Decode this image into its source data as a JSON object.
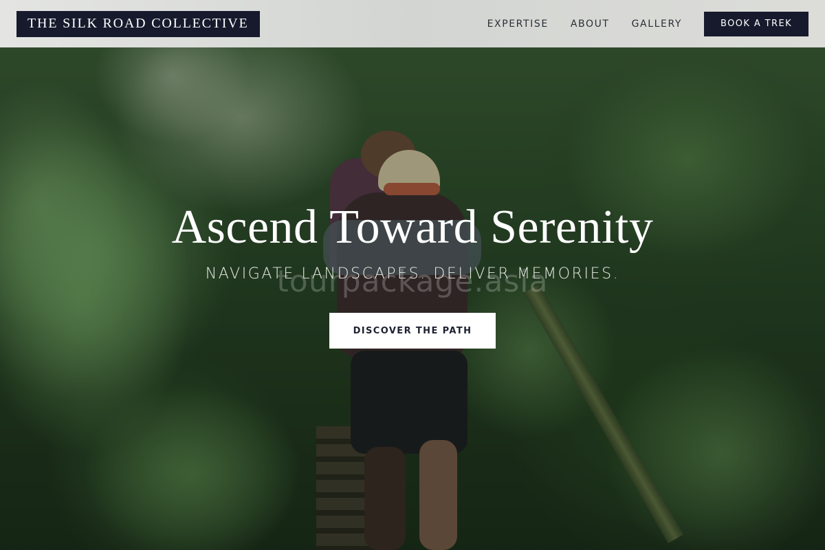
{
  "header": {
    "logo": "THE SILK ROAD COLLECTIVE",
    "nav": [
      {
        "label": "EXPERTISE"
      },
      {
        "label": "ABOUT"
      },
      {
        "label": "GALLERY"
      }
    ],
    "cta_label": "BOOK A TREK"
  },
  "hero": {
    "title": "Ascend Toward Serenity",
    "subtitle": "NAVIGATE LANDSCAPES. DELIVER MEMORIES.",
    "watermark": "tourpackage.asia",
    "cta_label": "DISCOVER THE PATH",
    "image_description": "hiker with backpack climbing wooden steps through a dense fern forest"
  },
  "colors": {
    "brand_navy": "#161a2c",
    "header_bg": "#dcddd9",
    "hero_cta_bg": "#ffffff",
    "hero_text": "#ffffff"
  }
}
